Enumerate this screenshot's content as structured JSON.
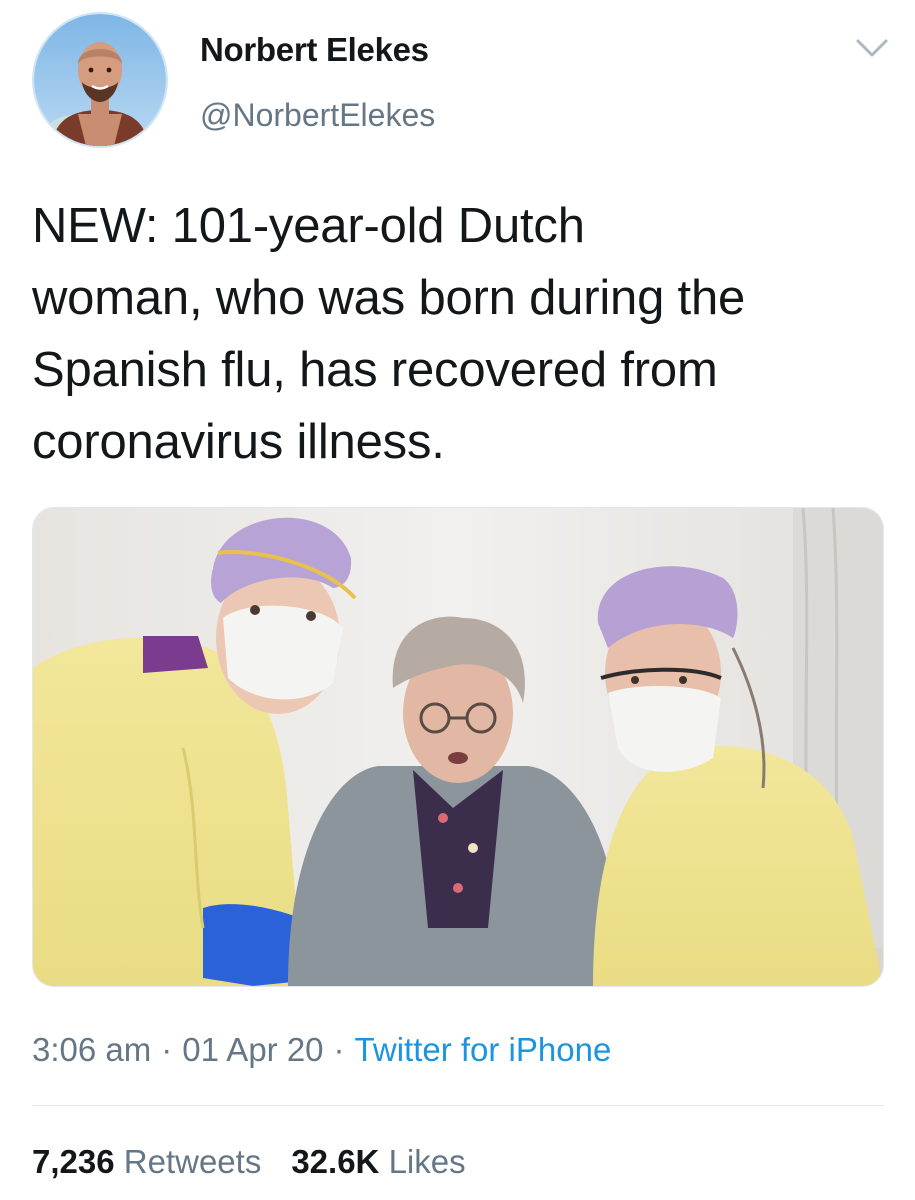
{
  "tweet": {
    "author": {
      "display_name": "Norbert Elekes",
      "handle": "@NorbertElekes",
      "avatar": "profile-photo"
    },
    "text_lines": [
      "NEW: 101-year-old Dutch",
      "woman, who was born during the",
      "Spanish flu, has recovered from",
      "coronavirus illness."
    ],
    "media": {
      "type": "photo"
    },
    "meta": {
      "time": "3:06 am",
      "date": "01 Apr 20",
      "separator": "·",
      "source": "Twitter for iPhone"
    },
    "stats": {
      "retweets_count": "7,236",
      "retweets_label": "Retweets",
      "likes_count": "32.6K",
      "likes_label": "Likes"
    }
  },
  "icons": {
    "more": "chevron-down-icon"
  },
  "colors": {
    "text": "#14171a",
    "secondary": "#657786",
    "link": "#1b95e0",
    "divider": "#e1e8ed"
  }
}
